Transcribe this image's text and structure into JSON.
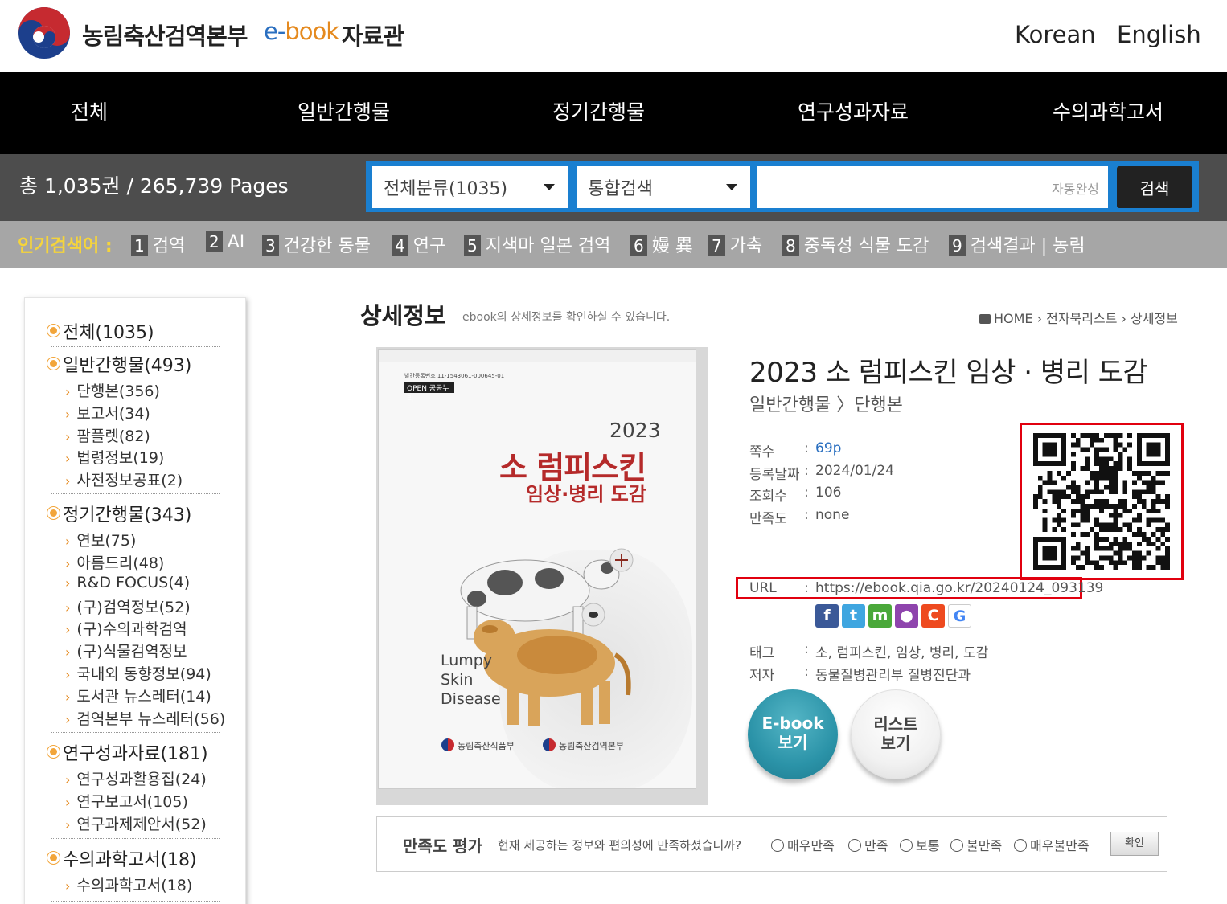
{
  "header": {
    "org_name": "농림축산검역본부",
    "ebook_prefix": "e-",
    "ebook_word": "book",
    "library": "자료관",
    "lang_korean": "Korean",
    "lang_english": "English"
  },
  "nav": {
    "items": [
      "전체",
      "일반간행물",
      "정기간행물",
      "연구성과자료",
      "수의과학고서"
    ]
  },
  "stats": {
    "text": "총 1,035권  /  265,739 Pages"
  },
  "search": {
    "category_selected": "전체분류(1035)",
    "type_selected": "통합검색",
    "input_value": "",
    "autocomplete_label": "자동완성",
    "button_label": "검색"
  },
  "popular": {
    "label": "인기검색어 :",
    "items": [
      {
        "rank": "1",
        "text": "검역"
      },
      {
        "rank": "2",
        "text": "AI"
      },
      {
        "rank": "3",
        "text": "건강한 동물"
      },
      {
        "rank": "4",
        "text": "연구"
      },
      {
        "rank": "5",
        "text": "지색마 일본 검역"
      },
      {
        "rank": "6",
        "text": "嫚 異"
      },
      {
        "rank": "7",
        "text": "가축"
      },
      {
        "rank": "8",
        "text": "중독성 식물 도감"
      },
      {
        "rank": "9",
        "text": "검색결과 | 농림"
      }
    ]
  },
  "sidebar": {
    "groups": [
      {
        "label": "전체(1035)",
        "subs": []
      },
      {
        "label": "일반간행물(493)",
        "subs": [
          "단행본(356)",
          "보고서(34)",
          "팜플렛(82)",
          "법령정보(19)",
          "사전정보공표(2)"
        ]
      },
      {
        "label": "정기간행물(343)",
        "subs": [
          "연보(75)",
          "아름드리(48)",
          "R&D FOCUS(4)",
          "(구)검역정보(52)",
          "(구)수의과학검역",
          "(구)식물검역정보",
          "국내외 동향정보(94)",
          "도서관 뉴스레터(14)",
          "검역본부 뉴스레터(56)"
        ]
      },
      {
        "label": "연구성과자료(181)",
        "subs": [
          "연구성과활용집(24)",
          "연구보고서(105)",
          "연구과제제안서(52)"
        ]
      },
      {
        "label": "수의과학고서(18)",
        "subs": [
          "수의과학고서(18)"
        ]
      }
    ]
  },
  "content": {
    "page_title": "상세정보",
    "page_desc": "ebook의 상세정보를 확인하실 수 있습니다.",
    "breadcrumb": "HOME  ›  전자북리스트  ›  상세정보"
  },
  "cover": {
    "small_text": "발간등록번호 11-1543061-000645-01",
    "open_badge": "OPEN 공공누리",
    "year": "2023",
    "title": "소 럼피스킨",
    "subtitle": "임상·병리 도감",
    "eng_line1": "Lumpy",
    "eng_line2": "Skin",
    "eng_line3": "Disease",
    "publisher1": "농림축산식품부",
    "publisher2": "농림축산검역본부"
  },
  "book": {
    "title": "2023 소 럼피스킨 임상 · 병리 도감",
    "category": "일반간행물 〉단행본",
    "pages_label": "쪽수",
    "pages_value": "69p",
    "date_label": "등록날짜",
    "date_value": "2024/01/24",
    "views_label": "조회수",
    "views_value": "106",
    "satis_label": "만족도",
    "satis_value": "none",
    "url_label": "URL",
    "url_value": "https://ebook.qia.go.kr/20240124_093139",
    "tag_label": "태그",
    "tag_value": "소, 럼피스킨, 임상, 병리, 도감",
    "author_label": "저자",
    "author_value": "동물질병관리부 질병진단과",
    "colon": ":"
  },
  "share": [
    {
      "icon": "facebook-icon",
      "glyph": "f",
      "color": "#3b5998"
    },
    {
      "icon": "twitter-icon",
      "glyph": "t",
      "color": "#3fa6e0"
    },
    {
      "icon": "me2day-icon",
      "glyph": "m",
      "color": "#4aa83a"
    },
    {
      "icon": "talk-icon",
      "glyph": "●",
      "color": "#8e44ad"
    },
    {
      "icon": "cyworld-icon",
      "glyph": "C",
      "color": "#ee4a1f"
    },
    {
      "icon": "google-icon",
      "glyph": "G",
      "color": "#ffffff"
    }
  ],
  "buttons": {
    "ebook_line1": "E-book",
    "ebook_line2": "보기",
    "list_line1": "리스트",
    "list_line2": "보기"
  },
  "satisfaction": {
    "title": "만족도 평가",
    "question": "현재 제공하는 정보와 편의성에 만족하셨습니까?",
    "options": [
      "매우만족",
      "만족",
      "보통",
      "불만족",
      "매우불만족"
    ],
    "confirm": "확인"
  }
}
